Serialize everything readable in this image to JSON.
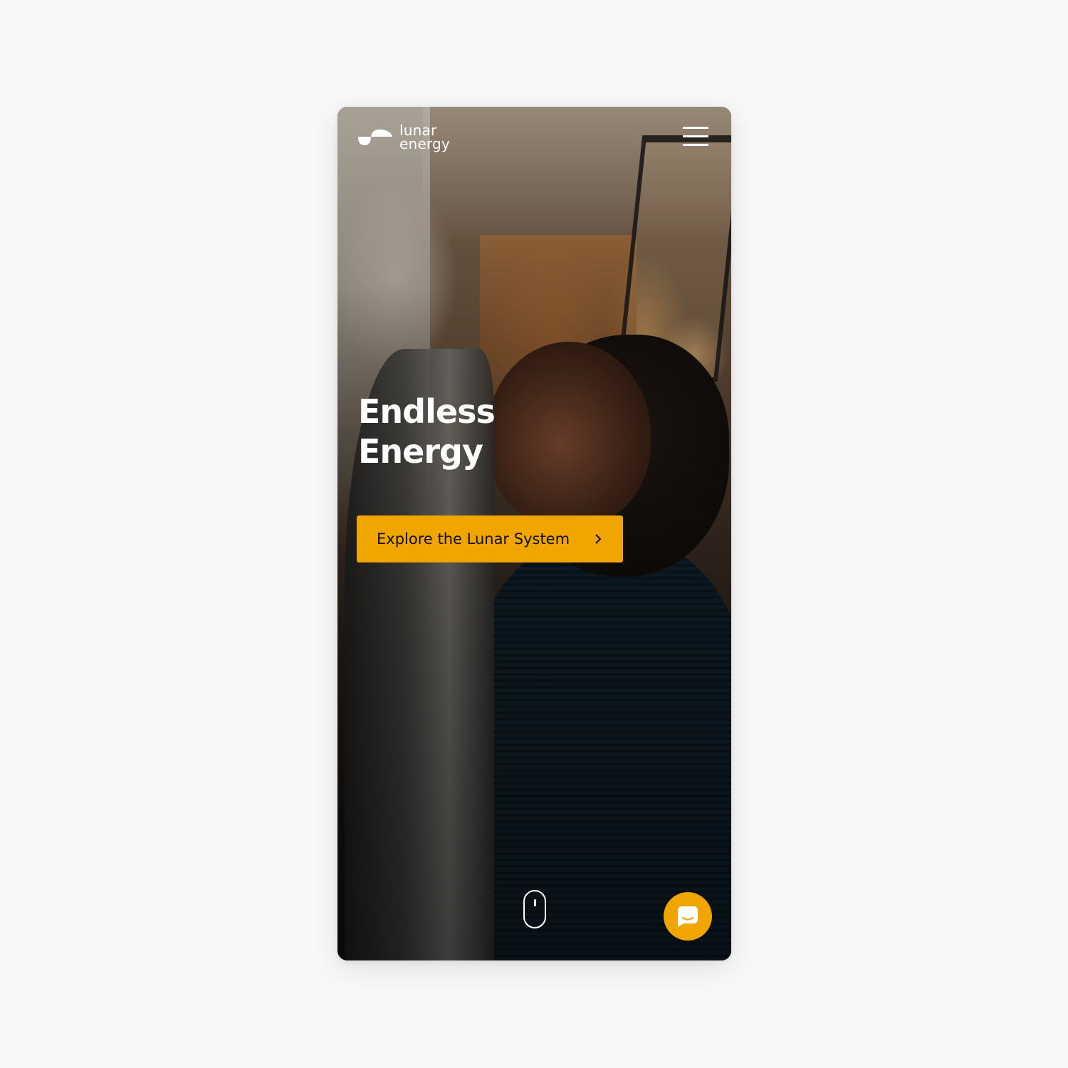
{
  "brand": {
    "name_line1": "lunar",
    "name_line2": "energy",
    "accent_color": "#f0a500"
  },
  "header": {
    "menu_icon": "hamburger-menu-icon"
  },
  "hero": {
    "title_line1": "Endless",
    "title_line2": "Energy",
    "cta_label": "Explore the Lunar System",
    "cta_icon": "chevron-right-icon"
  },
  "footer": {
    "scroll_icon": "mouse-scroll-icon",
    "chat_icon": "chat-bubble-icon"
  }
}
